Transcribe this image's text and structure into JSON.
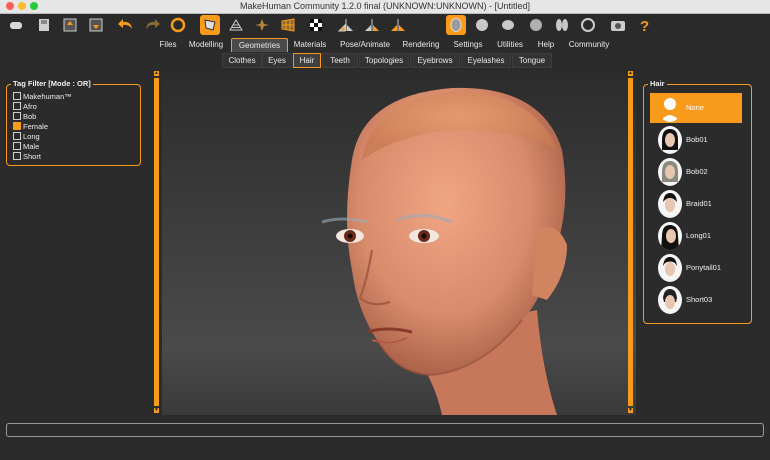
{
  "window": {
    "title": "MakeHuman Community 1.2.0 final (UNKNOWN:UNKNOWN) - [Untitled]"
  },
  "toolbar": {
    "icons": [
      "new-icon",
      "save-icon",
      "export-icon",
      "load-icon",
      "undo-icon",
      "redo-icon",
      "reset-icon",
      "smooth-icon",
      "wireframe-icon",
      "pose-icon",
      "grid-icon",
      "checker-icon",
      "symmetry-right-icon",
      "symmetry-left-icon",
      "symmetry-icon",
      "front-view-icon",
      "back-view-icon",
      "left-view-icon",
      "right-view-icon",
      "top-view-icon",
      "bottom-view-icon",
      "reset-camera-icon",
      "screenshot-icon",
      "help-icon"
    ],
    "accent": "#f89a1c"
  },
  "main_tabs": [
    "Files",
    "Modelling",
    "Geometries",
    "Materials",
    "Pose/Animate",
    "Rendering",
    "Settings",
    "Utilities",
    "Help",
    "Community"
  ],
  "main_tabs_selected": "Geometries",
  "sub_tabs": [
    "Clothes",
    "Eyes",
    "Hair",
    "Teeth",
    "Topologies",
    "Eyebrows",
    "Eyelashes",
    "Tongue"
  ],
  "sub_tabs_selected": "Hair",
  "tag_filter": {
    "title": "Tag Filter [Mode : OR]",
    "items": [
      {
        "label": "Makehuman™",
        "checked": false
      },
      {
        "label": "Afro",
        "checked": false
      },
      {
        "label": "Bob",
        "checked": false
      },
      {
        "label": "Female",
        "checked": true
      },
      {
        "label": "Long",
        "checked": false
      },
      {
        "label": "Male",
        "checked": false
      },
      {
        "label": "Short",
        "checked": false
      }
    ]
  },
  "hair_panel": {
    "title": "Hair",
    "items": [
      {
        "label": "None",
        "selected": true
      },
      {
        "label": "Bob01",
        "selected": false
      },
      {
        "label": "Bob02",
        "selected": false
      },
      {
        "label": "Braid01",
        "selected": false
      },
      {
        "label": "Long01",
        "selected": false
      },
      {
        "label": "Ponytail01",
        "selected": false
      },
      {
        "label": "Short03",
        "selected": false
      }
    ]
  },
  "colors": {
    "accent": "#f89a1c",
    "background": "#2b2b2b",
    "skin": "#d98c6c"
  }
}
